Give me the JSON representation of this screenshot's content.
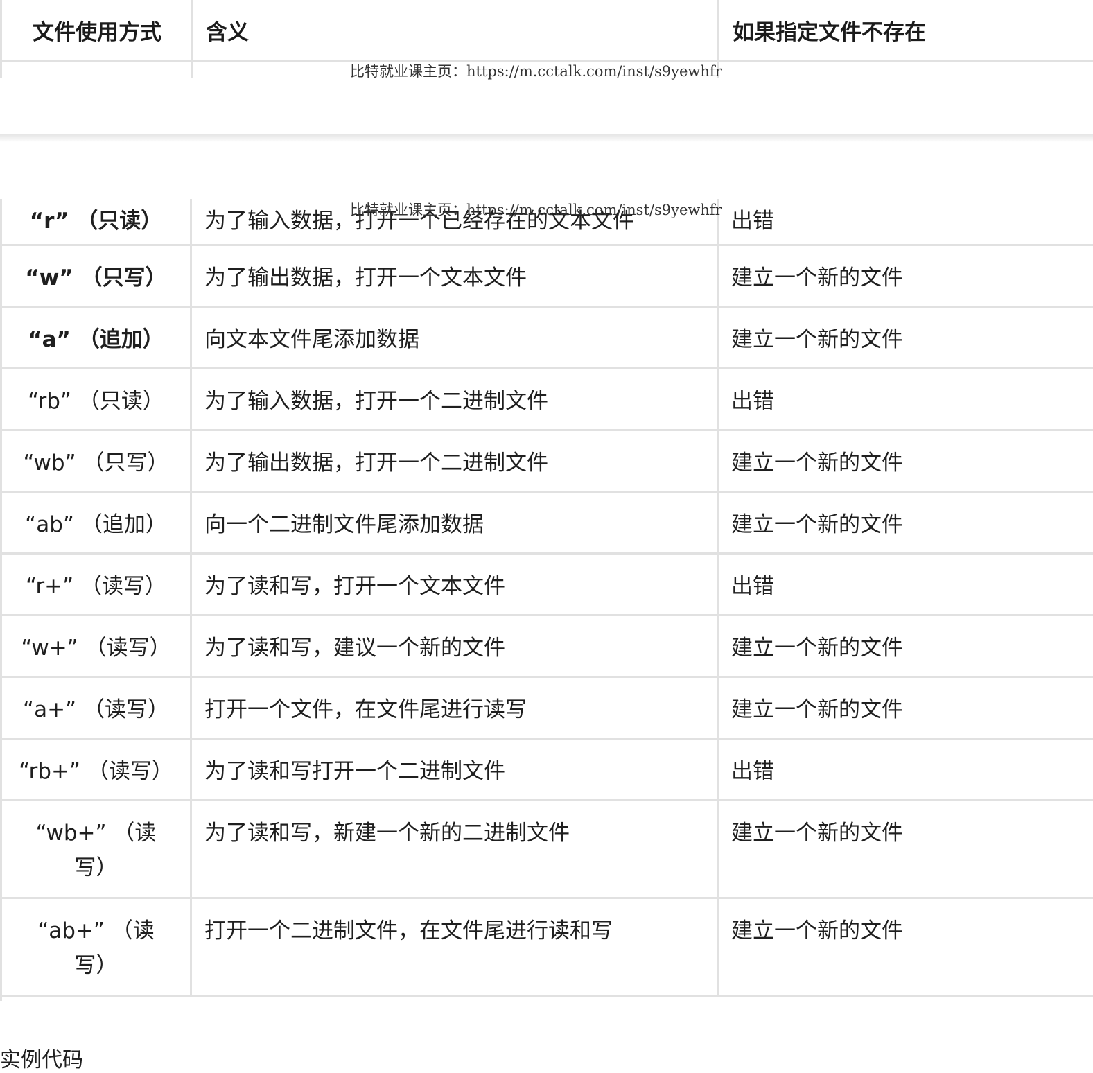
{
  "header": {
    "col1": "文件使用方式",
    "col2": "含义",
    "col3": "如果指定文件不存在"
  },
  "watermark": "比特就业课主页：https://m.cctalk.com/inst/s9yewhfr",
  "rows": [
    {
      "mode": "“r” （只读）",
      "meaning": "为了输入数据，打开一个已经存在的文本文件",
      "if_missing": "出错",
      "bold": true
    },
    {
      "mode": "“w” （只写）",
      "meaning": "为了输出数据，打开一个文本文件",
      "if_missing": "建立一个新的文件",
      "bold": true
    },
    {
      "mode": "“a” （追加）",
      "meaning": "向文本文件尾添加数据",
      "if_missing": "建立一个新的文件",
      "bold": true
    },
    {
      "mode": "“rb” （只读）",
      "meaning": "为了输入数据，打开一个二进制文件",
      "if_missing": "出错",
      "bold": false
    },
    {
      "mode": "“wb” （只写）",
      "meaning": "为了输出数据，打开一个二进制文件",
      "if_missing": "建立一个新的文件",
      "bold": false
    },
    {
      "mode": "“ab” （追加）",
      "meaning": "向一个二进制文件尾添加数据",
      "if_missing": "建立一个新的文件",
      "bold": false
    },
    {
      "mode": "“r+” （读写）",
      "meaning": "为了读和写，打开一个文本文件",
      "if_missing": "出错",
      "bold": false
    },
    {
      "mode": "“w+” （读写）",
      "meaning": "为了读和写，建议一个新的文件",
      "if_missing": "建立一个新的文件",
      "bold": false
    },
    {
      "mode": "“a+” （读写）",
      "meaning": "打开一个文件，在文件尾进行读写",
      "if_missing": "建立一个新的文件",
      "bold": false
    },
    {
      "mode": "“rb+” （读写）",
      "meaning": "为了读和写打开一个二进制文件",
      "if_missing": "出错",
      "bold": false
    },
    {
      "mode": "“wb+” （读写）",
      "meaning": "为了读和写，新建一个新的二进制文件",
      "if_missing": "建立一个新的文件",
      "bold": false
    },
    {
      "mode": "“ab+” （读写）",
      "meaning": "打开一个二进制文件，在文件尾进行读和写",
      "if_missing": "建立一个新的文件",
      "bold": false
    }
  ],
  "caption": "实例代码"
}
